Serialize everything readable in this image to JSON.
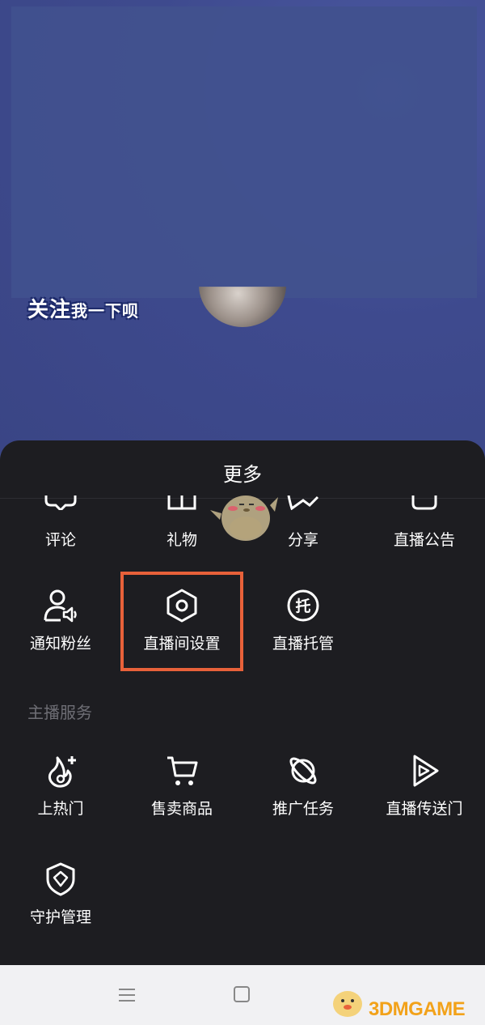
{
  "live": {
    "follow_main": "关注",
    "follow_small": "我一下呗"
  },
  "sheet": {
    "title": "更多",
    "row1": [
      {
        "label": "评论",
        "icon": "comment-icon"
      },
      {
        "label": "礼物",
        "icon": "gift-icon"
      },
      {
        "label": "分享",
        "icon": "share-icon"
      },
      {
        "label": "直播公告",
        "icon": "announcement-icon"
      }
    ],
    "row2": [
      {
        "label": "通知粉丝",
        "icon": "notify-fans-icon"
      },
      {
        "label": "直播间设置",
        "icon": "settings-hexagon-icon"
      },
      {
        "label": "直播托管",
        "icon": "hosting-icon"
      }
    ],
    "section_title": "主播服务",
    "row3": [
      {
        "label": "上热门",
        "icon": "hot-boost-icon"
      },
      {
        "label": "售卖商品",
        "icon": "cart-icon"
      },
      {
        "label": "推广任务",
        "icon": "planet-icon"
      },
      {
        "label": "直播传送门",
        "icon": "portal-play-icon"
      }
    ],
    "row4": [
      {
        "label": "守护管理",
        "icon": "shield-icon"
      }
    ],
    "host_char": "托"
  },
  "watermark": {
    "text": "3DMGAME"
  },
  "colors": {
    "sheet_bg": "#1d1d21",
    "highlight": "#e8613a",
    "section_title": "#6e6e75",
    "watermark": "#f2a21a"
  }
}
